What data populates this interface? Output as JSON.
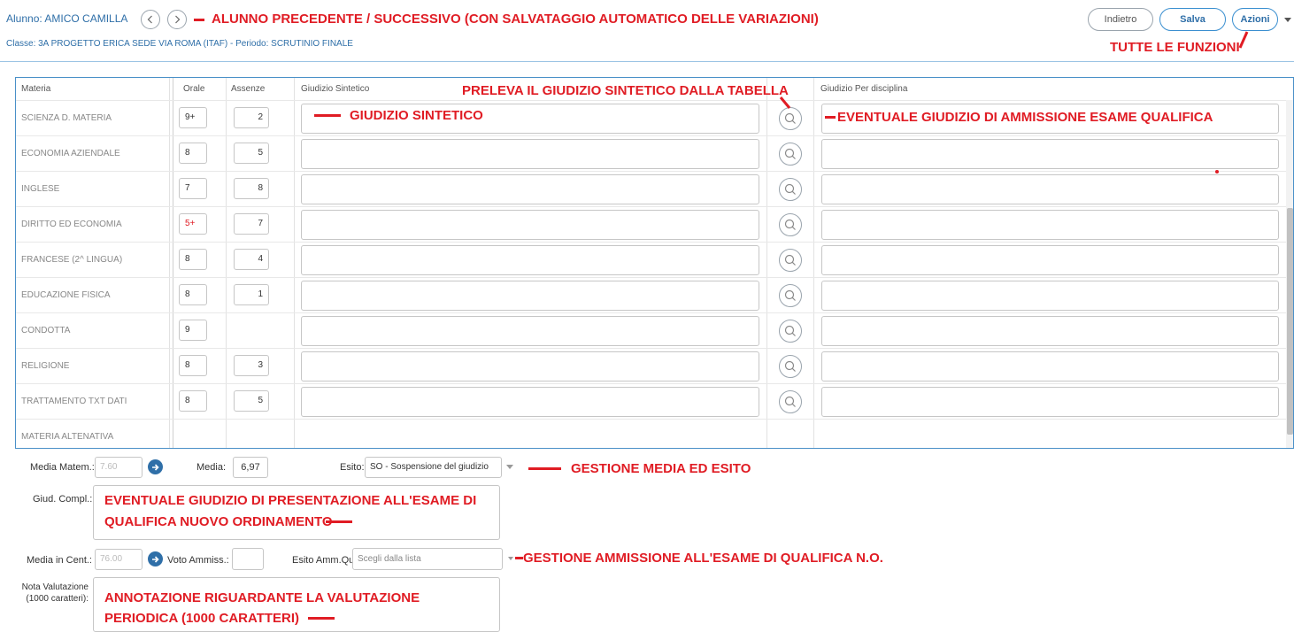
{
  "header": {
    "student": "Alunno: AMICO CAMILLA",
    "class_line": "Classe: 3A PROGETTO ERICA SEDE VIA ROMA (ITAF) - Periodo: SCRUTINIO FINALE",
    "back_label": "Indietro",
    "save_label": "Salva",
    "actions_label": "Azioni"
  },
  "table": {
    "headers": {
      "materia": "Materia",
      "orale": "Orale",
      "assenze": "Assenze",
      "giudizio": "Giudizio Sintetico",
      "disciplina": "Giudizio Per disciplina"
    },
    "rows": [
      {
        "subject": "SCIENZA D. MATERIA",
        "orale": "9+",
        "assenze": "2",
        "red": false
      },
      {
        "subject": "ECONOMIA AZIENDALE",
        "orale": "8",
        "assenze": "5",
        "red": false
      },
      {
        "subject": "INGLESE",
        "orale": "7",
        "assenze": "8",
        "red": false
      },
      {
        "subject": "DIRITTO ED ECONOMIA",
        "orale": "5+",
        "assenze": "7",
        "red": true
      },
      {
        "subject": "FRANCESE (2^ LINGUA)",
        "orale": "8",
        "assenze": "4",
        "red": false
      },
      {
        "subject": "EDUCAZIONE FISICA",
        "orale": "8",
        "assenze": "1",
        "red": false
      },
      {
        "subject": "CONDOTTA",
        "orale": "9",
        "assenze": "",
        "red": false
      },
      {
        "subject": "RELIGIONE",
        "orale": "8",
        "assenze": "3",
        "red": false
      },
      {
        "subject": "TRATTAMENTO TXT DATI",
        "orale": "8",
        "assenze": "5",
        "red": false
      },
      {
        "subject": "MATERIA ALTENATIVA",
        "orale": "",
        "assenze": "",
        "red": false
      }
    ]
  },
  "bottom": {
    "media_matem_label": "Media Matem.:",
    "media_matem_value": "7.60",
    "media_label": "Media:",
    "media_value": "6,97",
    "esito_label": "Esito:",
    "esito_value": "SO - Sospensione del giudizio",
    "giud_compl_label": "Giud. Compl.:",
    "media_cent_label": "Media in Cent.:",
    "media_cent_value": "76.00",
    "voto_ammiss_label": "Voto Ammiss.:",
    "esito_amm_label": "Esito Amm.Qual.:",
    "esito_amm_placeholder": "Scegli dalla lista",
    "nota_label_1": "Nota Valutazione",
    "nota_label_2": "(1000 caratteri):"
  },
  "annotations": {
    "nav": "ALUNNO PRECEDENTE / SUCCESSIVO  (CON SALVATAGGIO AUTOMATICO DELLE VARIAZIONI)",
    "functions": "TUTTE LE FUNZIONI",
    "preleva": "PRELEVA IL GIUDIZIO SINTETICO DALLA TABELLA",
    "giudizio": "GIUDIZIO SINTETICO",
    "ammissione": "EVENTUALE GIUDIZIO DI AMMISSIONE ESAME QUALIFICA",
    "media_esito": "GESTIONE MEDIA ED ESITO",
    "presentazione_1": "EVENTUALE GIUDIZIO DI PRESENTAZIONE ALL'ESAME DI",
    "presentazione_2": "QUALIFICA NUOVO ORDINAMENTO",
    "gestione_amm": "GESTIONE AMMISSIONE ALL'ESAME DI QUALIFICA N.O.",
    "nota_1": "ANNOTAZIONE RIGUARDANTE LA VALUTAZIONE",
    "nota_2": "PERIODICA (1000 CARATTERI)"
  },
  "colors": {
    "accent": "#3a8fd0",
    "annotation": "#e01c24",
    "failing_grade": "#e01c24"
  }
}
